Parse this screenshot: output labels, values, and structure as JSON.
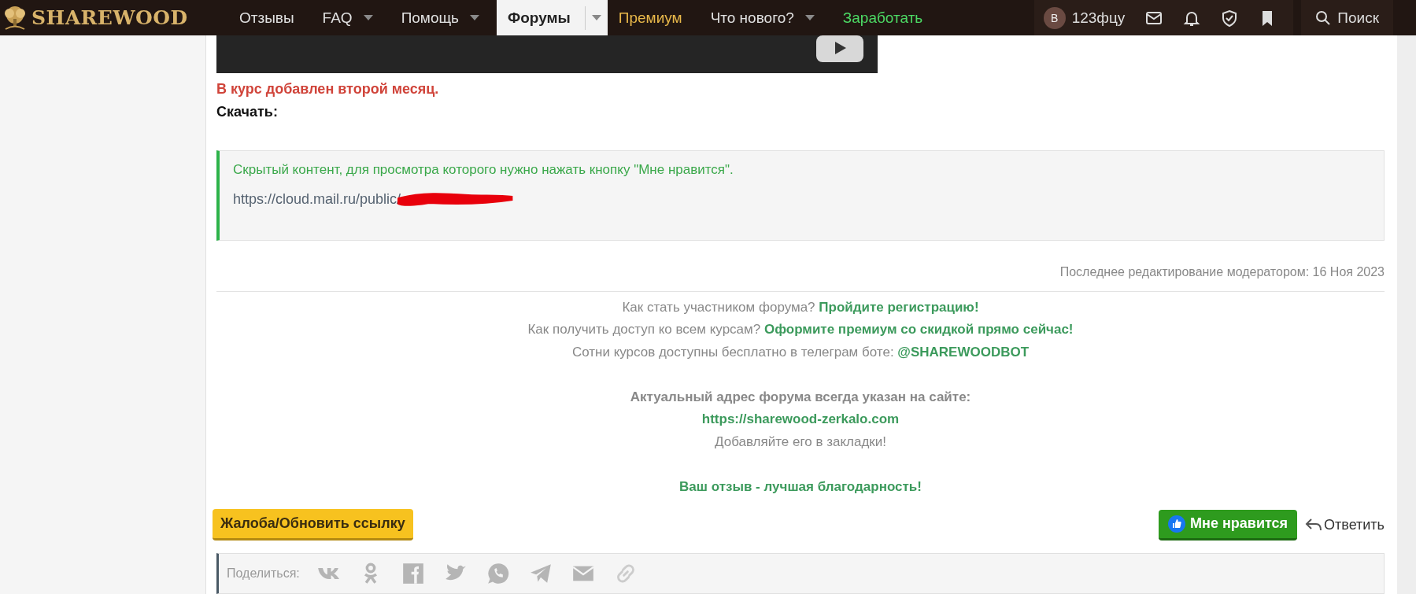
{
  "nav": {
    "logo": "SHAREWOOD",
    "items": [
      {
        "label": "Отзывы",
        "dropdown": false,
        "selected": false,
        "color": "#e0e0e0"
      },
      {
        "label": "FAQ",
        "dropdown": true,
        "selected": false,
        "color": "#e0e0e0"
      },
      {
        "label": "Помощь",
        "dropdown": true,
        "selected": false,
        "color": "#e0e0e0"
      },
      {
        "label": "Форумы",
        "dropdown": true,
        "selected": true,
        "color": "#222222"
      },
      {
        "label": "Премиум",
        "dropdown": false,
        "selected": false,
        "color": "#e8b84a"
      },
      {
        "label": "Что нового?",
        "dropdown": true,
        "selected": false,
        "color": "#e0e0e0"
      },
      {
        "label": "Заработать",
        "dropdown": false,
        "selected": false,
        "color": "#4cd964"
      }
    ],
    "user": {
      "avatar_letter": "В",
      "name": "123фцу"
    },
    "search": "Поиск"
  },
  "post": {
    "notice": "В курс добавлен второй месяц.",
    "download_label": "Скачать:",
    "hidden": {
      "message": "Скрытый контент, для просмотра которого нужно нажать кнопку \"Мне нравится\".",
      "url": "https://cloud.mail.ru/public/"
    },
    "edit_note": "Последнее редактирование модератором: 16 Ноя 2023",
    "promo": [
      {
        "text": "Как стать участником форума?",
        "link": "Пройдите регистрацию!"
      },
      {
        "text": "Как получить доступ ко всем курсам?",
        "link": "Оформите премиум со скидкой прямо сейчас!"
      },
      {
        "text": "Сотни курсов доступны бесплатно в телеграм боте:",
        "link": "@SHAREWOODBOT"
      }
    ],
    "address": {
      "title": "Актуальный адрес форума всегда указан на сайте:",
      "link": "https://sharewood-zerkalo.com",
      "hint": "Добавляйте его в закладки!"
    },
    "thanks": "Ваш отзыв - лучшая благодарность!",
    "report_button": "Жалоба/Обновить ссылку",
    "like_button": "Мне нравится",
    "reply_button": "Ответить",
    "share_label": "Поделиться:"
  }
}
